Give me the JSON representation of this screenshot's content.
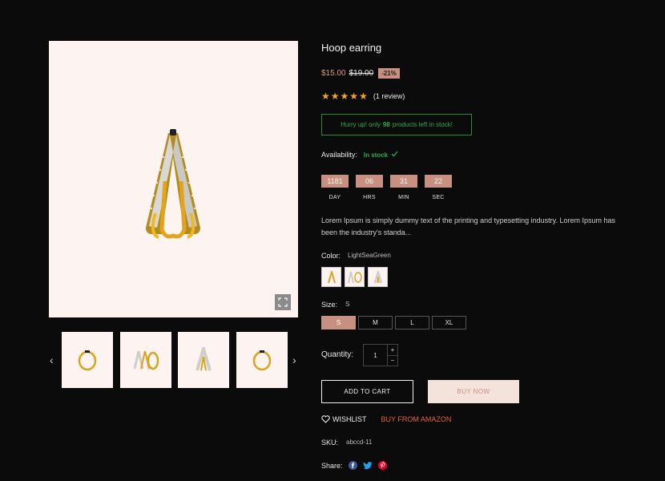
{
  "product": {
    "title": "Hoop earring",
    "price_new": "$15.00",
    "price_old": "$19.00",
    "discount": "-21%",
    "rating": 5,
    "review_text": "(1 review)",
    "stock_pre": "Hurry up! only",
    "stock_count": "98",
    "stock_post": "products left in stock!",
    "availability_label": "Availability:",
    "availability_value": "In stock",
    "description": "Lorem Ipsum is simply dummy text of the printing and typesetting industry. Lorem Ipsum has been the industry's standa..."
  },
  "countdown": [
    {
      "value": "1181",
      "label": "DAY"
    },
    {
      "value": "06",
      "label": "HRS"
    },
    {
      "value": "31",
      "label": "MIN"
    },
    {
      "value": "22",
      "label": "SEC"
    }
  ],
  "color": {
    "label": "Color:",
    "value": "LightSeaGreen"
  },
  "size": {
    "label": "Size:",
    "value": "S",
    "options": [
      "S",
      "M",
      "L",
      "XL"
    ]
  },
  "quantity": {
    "label": "Quantity:",
    "value": "1",
    "plus": "+",
    "minus": "−"
  },
  "actions": {
    "add_to_cart": "ADD TO CART",
    "buy_now": "BUY NOW",
    "wishlist": "WISHLIST",
    "amazon": "BUY FROM AMAZON"
  },
  "sku": {
    "label": "SKU:",
    "value": "abccd-11"
  },
  "share": {
    "label": "Share:"
  },
  "gallery": {
    "prev_arrow": "‹",
    "next_arrow": "›",
    "thumbs": [
      "hoop-front",
      "hoop-pair",
      "hoop-side",
      "hoop-front"
    ],
    "zoom_icon": "expand-icon"
  },
  "colors": {
    "accent": "#c79080",
    "success": "#34a853",
    "star": "#f2a623",
    "amazon": "#e0633d",
    "product_bg": "#fdf3f1"
  }
}
